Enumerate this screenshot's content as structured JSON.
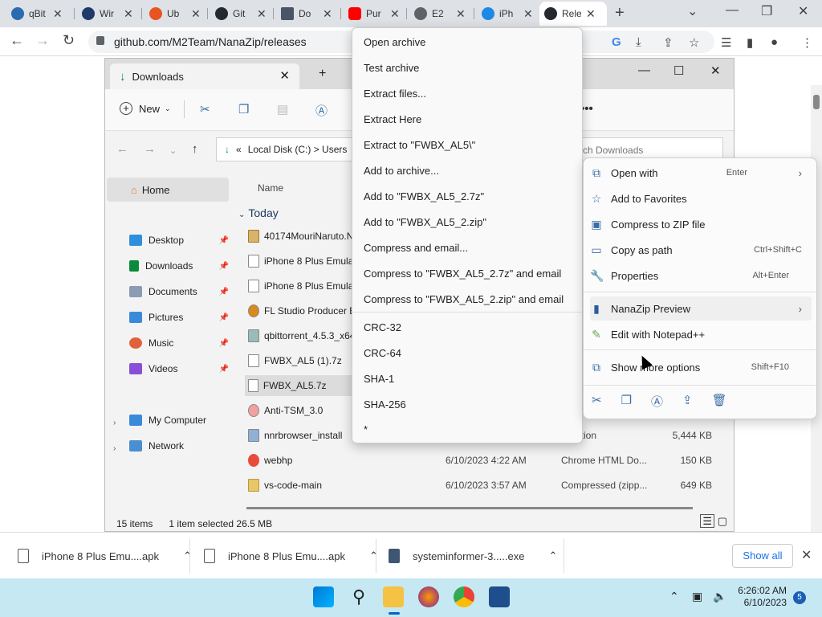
{
  "browser": {
    "tabs": [
      {
        "label": "qBit",
        "color": "#2b6cb0"
      },
      {
        "label": "Wir",
        "color": "#1d3a6b"
      },
      {
        "label": "Ub",
        "color": "#e95420"
      },
      {
        "label": "Git",
        "color": "#24292f"
      },
      {
        "label": "Do",
        "color": "#4a5568"
      },
      {
        "label": "Pur",
        "color": "#ff0000"
      },
      {
        "label": "E2",
        "color": "#5f6368"
      },
      {
        "label": "iPh",
        "color": "#1e88e5"
      },
      {
        "label": "Rele",
        "color": "#24292f"
      }
    ],
    "url": "github.com/M2Team/NanaZip/releases"
  },
  "explorer": {
    "tab_title": "Downloads",
    "new_label": "New",
    "path_prefix": "«",
    "path": "Local Disk (C:)  >  Users",
    "search_placeholder": "rch Downloads",
    "sidebar": {
      "home": "Home",
      "pinned": [
        "Desktop",
        "Downloads",
        "Documents",
        "Pictures",
        "Music",
        "Videos"
      ],
      "tree": [
        "My Computer",
        "Network"
      ]
    },
    "column_name": "Name",
    "group": "Today",
    "files": [
      {
        "name": "40174MouriNaruto.N",
        "date": "",
        "type": "",
        "size": ""
      },
      {
        "name": "iPhone 8 Plus Emulat",
        "date": "",
        "type": "",
        "size": ""
      },
      {
        "name": "iPhone 8 Plus Emulat",
        "date": "",
        "type": "",
        "size": ""
      },
      {
        "name": "FL Studio Producer E",
        "date": "",
        "type": "",
        "size": ""
      },
      {
        "name": "qbittorrent_4.5.3_x64",
        "date": "",
        "type": "",
        "size": ""
      },
      {
        "name": "FWBX_AL5 (1).7z",
        "date": "",
        "type": "",
        "size": ""
      },
      {
        "name": "FWBX_AL5.7z",
        "date": "",
        "type": "",
        "size": ""
      },
      {
        "name": "Anti-TSM_3.0",
        "date": "",
        "type": "",
        "size": ""
      },
      {
        "name": "nnrbrowser_install",
        "date": "",
        "type": "plication",
        "size": "5,444 KB"
      },
      {
        "name": "webhp",
        "date": "6/10/2023 4:22 AM",
        "type": "Chrome HTML Do...",
        "size": "150 KB"
      },
      {
        "name": "vs-code-main",
        "date": "6/10/2023 3:57 AM",
        "type": "Compressed (zipp...",
        "size": "649 KB"
      }
    ],
    "status_items": "15 items",
    "status_selected": "1 item selected  26.5 MB"
  },
  "nanazip_menu": [
    "Open archive",
    "Test archive",
    "Extract files...",
    "Extract Here",
    "Extract to \"FWBX_AL5\\\"",
    "Add to archive...",
    "Add to \"FWBX_AL5_2.7z\"",
    "Add to \"FWBX_AL5_2.zip\"",
    "Compress and email...",
    "Compress to \"FWBX_AL5_2.7z\" and email",
    "Compress to \"FWBX_AL5_2.zip\" and email",
    "CRC-32",
    "CRC-64",
    "SHA-1",
    "SHA-256",
    "*"
  ],
  "win_menu": {
    "open_with": "Open with",
    "open_with_sc": "Enter",
    "favorites": "Add to Favorites",
    "zip": "Compress to ZIP file",
    "copy_path": "Copy as path",
    "copy_path_sc": "Ctrl+Shift+C",
    "properties": "Properties",
    "properties_sc": "Alt+Enter",
    "nanazip": "NanaZip Preview",
    "notepad": "Edit with Notepad++",
    "more": "Show more options",
    "more_sc": "Shift+F10"
  },
  "downloads": [
    "iPhone 8 Plus Emu....apk",
    "iPhone 8 Plus Emu....apk",
    "systeminformer-3.....exe"
  ],
  "show_all": "Show all",
  "clock": {
    "time": "6:26:02 AM",
    "date": "6/10/2023"
  },
  "notif_count": "5"
}
